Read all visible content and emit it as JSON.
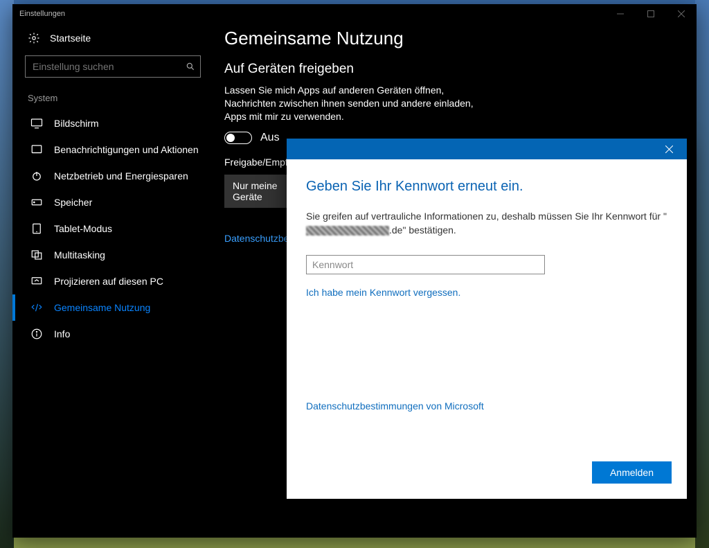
{
  "window": {
    "title": "Einstellungen"
  },
  "home": {
    "label": "Startseite"
  },
  "search": {
    "placeholder": "Einstellung suchen"
  },
  "section_label": "System",
  "nav": [
    {
      "label": "Bildschirm"
    },
    {
      "label": "Benachrichtigungen und Aktionen"
    },
    {
      "label": "Netzbetrieb und Energiesparen"
    },
    {
      "label": "Speicher"
    },
    {
      "label": "Tablet-Modus"
    },
    {
      "label": "Multitasking"
    },
    {
      "label": "Projizieren auf diesen PC"
    },
    {
      "label": "Gemeinsame Nutzung"
    },
    {
      "label": "Info"
    }
  ],
  "page": {
    "title": "Gemeinsame Nutzung",
    "subtitle": "Auf Geräten freigeben",
    "description": "Lassen Sie mich Apps auf anderen Geräten öffnen, Nachrichten zwischen ihnen senden und andere einladen, Apps mit mir zu verwenden.",
    "toggle_state": "Aus",
    "share_label": "Freigabe/Empfang",
    "dropdown_value": "Nur meine Geräte",
    "privacy_link": "Datenschutzbestimmungen"
  },
  "dialog": {
    "heading": "Geben Sie Ihr Kennwort erneut ein.",
    "info_prefix": "Sie greifen auf vertrauliche Informationen zu, deshalb müssen Sie Ihr Kennwort für \"",
    "info_suffix": ".de\" bestätigen.",
    "password_placeholder": "Kennwort",
    "forgot": "Ich habe mein Kennwort vergessen.",
    "ms_privacy": "Datenschutzbestimmungen von Microsoft",
    "login": "Anmelden"
  }
}
